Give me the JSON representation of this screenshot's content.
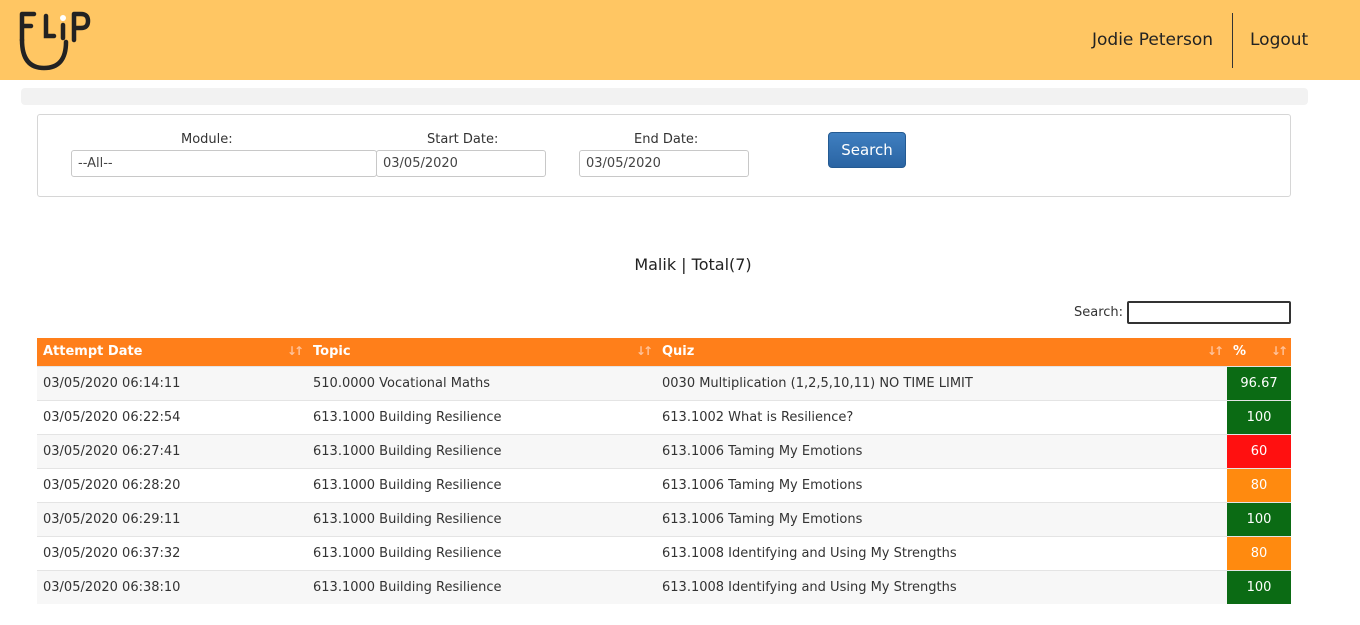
{
  "header": {
    "logo_text": "FLIP",
    "user_name": "Jodie Peterson",
    "logout_label": "Logout"
  },
  "filters": {
    "module_label": "Module:",
    "module_value": "--All--",
    "start_label": "Start Date:",
    "start_value": "03/05/2020",
    "end_label": "End Date:",
    "end_value": "03/05/2020",
    "search_label": "Search"
  },
  "summary": "Malik | Total(7)",
  "table_search_label": "Search:",
  "columns": [
    "Attempt Date",
    "Topic",
    "Quiz",
    "%"
  ],
  "rows": [
    {
      "date": "03/05/2020 06:14:11",
      "topic": "510.0000 Vocational Maths",
      "quiz": "0030 Multiplication (1,2,5,10,11) NO TIME LIMIT",
      "pct": "96.67",
      "color": "#0b6b14"
    },
    {
      "date": "03/05/2020 06:22:54",
      "topic": "613.1000 Building Resilience",
      "quiz": "613.1002 What is Resilience?",
      "pct": "100",
      "color": "#0b6b14"
    },
    {
      "date": "03/05/2020 06:27:41",
      "topic": "613.1000 Building Resilience",
      "quiz": "613.1006 Taming My Emotions",
      "pct": "60",
      "color": "#ff1010"
    },
    {
      "date": "03/05/2020 06:28:20",
      "topic": "613.1000 Building Resilience",
      "quiz": "613.1006 Taming My Emotions",
      "pct": "80",
      "color": "#ff8a0f"
    },
    {
      "date": "03/05/2020 06:29:11",
      "topic": "613.1000 Building Resilience",
      "quiz": "613.1006 Taming My Emotions",
      "pct": "100",
      "color": "#0b6b14"
    },
    {
      "date": "03/05/2020 06:37:32",
      "topic": "613.1000 Building Resilience",
      "quiz": "613.1008 Identifying and Using My Strengths",
      "pct": "80",
      "color": "#ff8a0f"
    },
    {
      "date": "03/05/2020 06:38:10",
      "topic": "613.1000 Building Resilience",
      "quiz": "613.1008 Identifying and Using My Strengths",
      "pct": "100",
      "color": "#0b6b14"
    }
  ]
}
